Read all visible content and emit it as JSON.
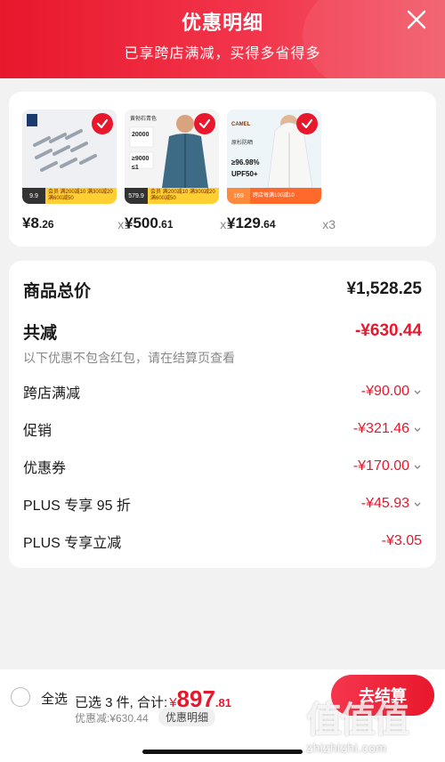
{
  "header": {
    "title": "优惠明细",
    "subtitle": "已享跨店满减，买得多省得多"
  },
  "products": [
    {
      "price_main": "¥8",
      "price_decimal": ".26",
      "qty": "x1",
      "thumb_bg": "#eef0f3",
      "promo_price": "9.9",
      "promo_text": "会员 满200减10 满300减20 满600减50",
      "image_text": [],
      "icons": [
        "bolt-pins-image"
      ]
    },
    {
      "price_main": "¥500",
      "price_decimal": ".61",
      "qty": "x1",
      "thumb_bg": "#f4f4f4",
      "promo_price": "579.9",
      "promo_text": "会员 满200减10 满300减20 满600减50",
      "image_text": [
        "黄勃石青色",
        "20000",
        "9000",
        "1"
      ],
      "icons": [
        "man-jacket-image"
      ]
    },
    {
      "price_main": "¥129",
      "price_decimal": ".64",
      "qty": "x3",
      "thumb_bg": "#eef5f9",
      "promo_price": "169",
      "promo_text": "跨店每满100减10",
      "image_text": [
        "CAMEL",
        "原杉防晒",
        "≥96.98%",
        "UPF50+"
      ],
      "icons": [
        "woman-jacket-image"
      ]
    }
  ],
  "summary": {
    "total_label": "商品总价",
    "total_value": "¥1,528.25",
    "reduce_label": "共减",
    "reduce_value": "-¥630.44",
    "note": "以下优惠不包含红包，请在结算页查看",
    "items": [
      {
        "label": "跨店满减",
        "value": "-¥90.00",
        "chevron": true
      },
      {
        "label": "促销",
        "value": "-¥321.46",
        "chevron": true
      },
      {
        "label": "优惠券",
        "value": "-¥170.00",
        "chevron": true
      },
      {
        "label": "PLUS 专享 95 折",
        "value": "-¥45.93",
        "chevron": true
      },
      {
        "label": "PLUS 专享立减",
        "value": "-¥3.05",
        "chevron": false
      }
    ]
  },
  "bottom": {
    "select_all": "全选",
    "selected": "已选 3 件, 合计:",
    "total_yen": "¥",
    "total_int": "897",
    "total_dec": ".81",
    "discount": "优惠减:¥630.44",
    "detail_chip": "优惠明细",
    "checkout": "去结算"
  },
  "watermark": {
    "logo": "值值值",
    "url": "zhizhizhi.com"
  },
  "colors": {
    "accent": "#e8172c",
    "header_gradient_end": "#f25b6a",
    "promo_yellow": "#ffcf33"
  }
}
